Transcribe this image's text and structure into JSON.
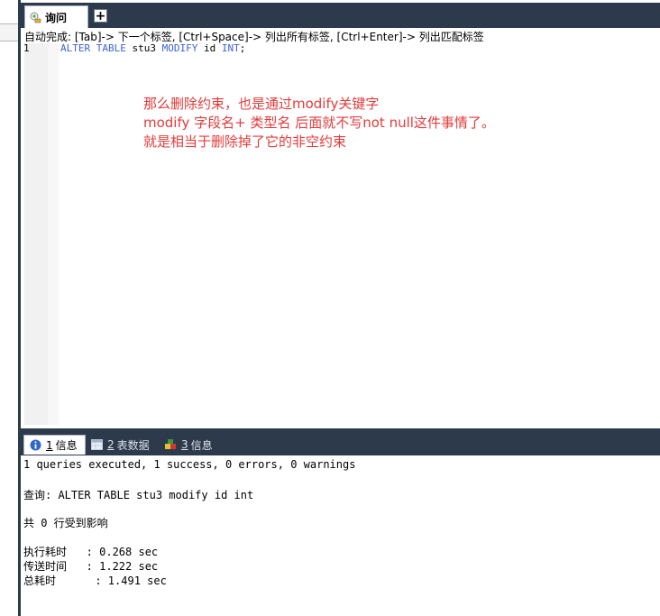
{
  "query_tab": {
    "label": "询问"
  },
  "add_tab": {
    "label": "+"
  },
  "editor": {
    "hint": "自动完成: [Tab]-> 下一个标签, [Ctrl+Space]-> 列出所有标签, [Ctrl+Enter]-> 列出匹配标签",
    "line_number": "1",
    "sql": {
      "k1": "ALTER",
      "k2": "TABLE",
      "table": "stu3",
      "k3": "MODIFY",
      "col": "id",
      "type": "INT",
      "end": ";"
    },
    "annotation": [
      "那么删除约束，也是通过modify关键字",
      "modify  字段名+  类型名 后面就不写not null这件事情了。",
      "就是相当于删除掉了它的非空约束"
    ]
  },
  "result_tabs": [
    {
      "num": "1",
      "label": "信息",
      "icon": "info-icon"
    },
    {
      "num": "2",
      "label": "表数据",
      "icon": "table-icon"
    },
    {
      "num": "3",
      "label": "信息",
      "icon": "info-blocks-icon"
    }
  ],
  "output": {
    "summary": "1 queries executed, 1 success, 0 errors, 0 warnings",
    "query": "查询: ALTER TABLE stu3 modify id int",
    "affected": "共 0 行受到影响",
    "exec_time": "执行耗时   : 0.268 sec",
    "transfer_time": "传送时间   : 1.222 sec",
    "total_time": "总耗时      : 1.491 sec"
  },
  "colors": {
    "chrome": "#2d3a4c",
    "keyword": "#3c63d6",
    "annotation": "#e53a3a"
  }
}
